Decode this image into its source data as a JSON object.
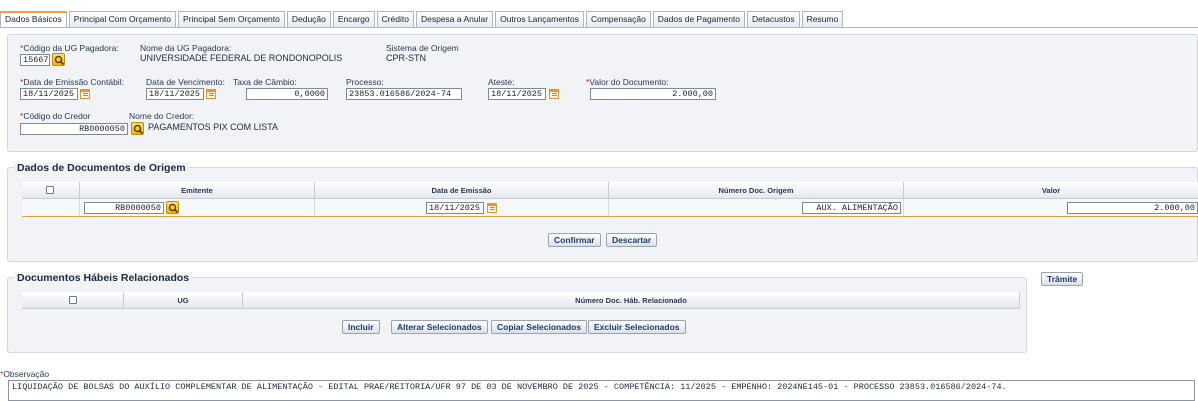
{
  "tabs": [
    "Dados Básicos",
    "Principal Com Orçamento",
    "Principal Sem Orçamento",
    "Dedução",
    "Encargo",
    "Crédito",
    "Despesa a Anular",
    "Outros Lançamentos",
    "Compensação",
    "Dados de Pagamento",
    "Detacustos",
    "Resumo"
  ],
  "header": {
    "ug_pagadora_code_label": "Código da UG Pagadora:",
    "ug_pagadora_code": "156677",
    "ug_pagadora_name_label": "Nome da UG Pagadora:",
    "ug_pagadora_name": "UNIVERSIDADE FEDERAL DE RONDONOPOLIS",
    "sistema_label": "Sistema de Origem",
    "sistema": "CPR-STN",
    "data_emissao_label": "Data de Emissão Contábil:",
    "data_emissao": "18/11/2025",
    "data_vencimento_label": "Data de Vencimento:",
    "data_vencimento": "18/11/2025",
    "taxa_cambio_label": "Taxa de Câmbio:",
    "taxa_cambio": "0,0000",
    "processo_label": "Processo:",
    "processo": "23853.016586/2024-74",
    "ateste_label": "Ateste:",
    "ateste": "18/11/2025",
    "valor_label": "Valor do Documento:",
    "valor": "2.000,00",
    "credor_code_label": "Código do Credor",
    "credor_code": "RB0000050",
    "credor_name_label": "Nome do Credor:",
    "credor_name": "PAGAMENTOS PIX COM LISTA",
    "required_mark": "*"
  },
  "origem": {
    "title": "Dados de Documentos de Origem",
    "columns": [
      "Emitente",
      "Data de Emissão",
      "Número Doc. Origem",
      "Valor"
    ],
    "row": {
      "emitente": "RB0000050",
      "data": "18/11/2025",
      "numero": "AUX. ALIMENTAÇÃO",
      "valor": "2.000,00"
    },
    "confirm_label": "Confirmar",
    "discard_label": "Descartar"
  },
  "habeis": {
    "title": "Documentos Hábeis Relacionados",
    "columns": [
      "UG",
      "Número Doc. Háb. Relacionado"
    ],
    "buttons": [
      "Incluir",
      "Alterar Selecionados",
      "Copiar Selecionados",
      "Excluir Selecionados"
    ],
    "tramite_label": "Trâmite"
  },
  "observacao": {
    "label": "Observação",
    "text": "LIQUIDAÇÃO DE BOLSAS DO AUXÍLIO COMPLEMENTAR DE ALIMENTAÇÃO - EDITAL PRAE/REITORIA/UFR 97 DE 03 DE NOVEMBRO DE 2025 - COMPETÊNCIA: 11/2025 - EMPENHO: 2024NE145-01 - PROCESSO 23853.016586/2024-74."
  },
  "icons": {
    "search": "search-icon",
    "calendar": "calendar-icon",
    "checkbox": "checkbox"
  },
  "colors": {
    "accent": "#e8a33d",
    "required": "#d4261f",
    "search_button": "#f2b500"
  }
}
